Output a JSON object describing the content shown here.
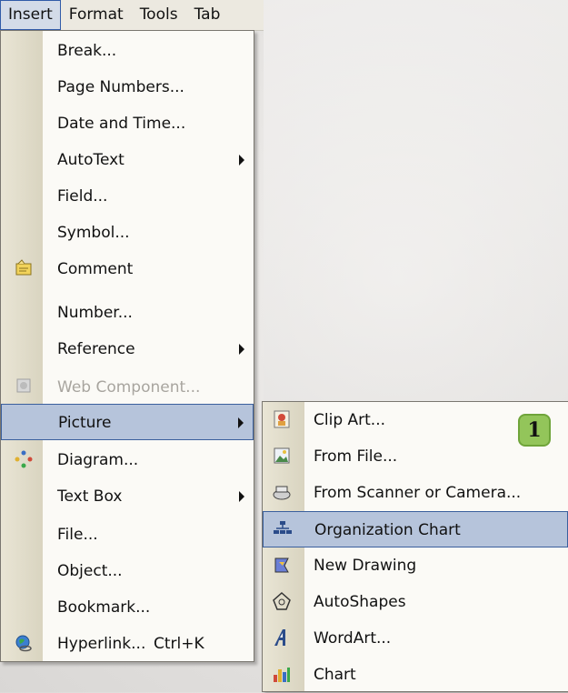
{
  "menubar": {
    "items": [
      "Insert",
      "Format",
      "Tools",
      "Tab"
    ]
  },
  "insert_menu": {
    "items": [
      {
        "label": "Break...",
        "shortcut": ""
      },
      {
        "label": "Page Numbers...",
        "shortcut": ""
      },
      {
        "label": "Date and Time...",
        "shortcut": ""
      },
      {
        "label": "AutoText",
        "shortcut": ""
      },
      {
        "label": "Field...",
        "shortcut": ""
      },
      {
        "label": "Symbol...",
        "shortcut": ""
      },
      {
        "label": "Comment",
        "shortcut": ""
      },
      {
        "label": "Number...",
        "shortcut": ""
      },
      {
        "label": "Reference",
        "shortcut": ""
      },
      {
        "label": "Web Component...",
        "shortcut": ""
      },
      {
        "label": "Picture",
        "shortcut": ""
      },
      {
        "label": "Diagram...",
        "shortcut": ""
      },
      {
        "label": "Text Box",
        "shortcut": ""
      },
      {
        "label": "File...",
        "shortcut": ""
      },
      {
        "label": "Object...",
        "shortcut": ""
      },
      {
        "label": "Bookmark...",
        "shortcut": ""
      },
      {
        "label": "Hyperlink...",
        "shortcut": "Ctrl+K"
      }
    ]
  },
  "picture_menu": {
    "items": [
      {
        "label": "Clip Art..."
      },
      {
        "label": "From File..."
      },
      {
        "label": "From Scanner or Camera..."
      },
      {
        "label": "Organization Chart"
      },
      {
        "label": "New Drawing"
      },
      {
        "label": "AutoShapes"
      },
      {
        "label": "WordArt..."
      },
      {
        "label": "Chart"
      }
    ]
  },
  "callout": {
    "number": "1"
  },
  "colors": {
    "selection": "#b6c4db",
    "selection_border": "#3a5f9d",
    "badge": "#93c55a"
  }
}
